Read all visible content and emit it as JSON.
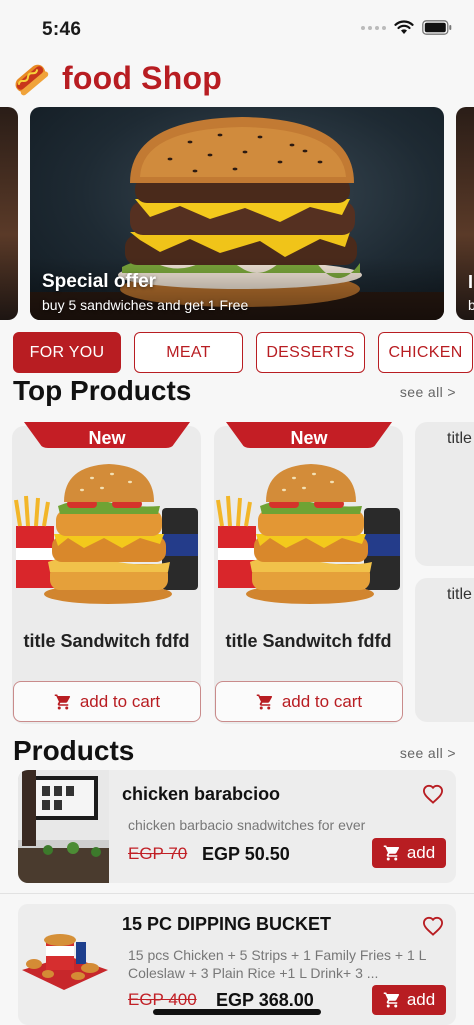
{
  "status_bar": {
    "time": "5:46"
  },
  "app": {
    "title": "food Shop"
  },
  "banner": {
    "title": "Special offer",
    "subtitle": "buy 5 sandwiches and get 1 Free",
    "next_peek_title": "I",
    "next_peek_sub": "b"
  },
  "categories": [
    {
      "label": "FOR YOU",
      "active": true
    },
    {
      "label": "MEAT",
      "active": false
    },
    {
      "label": "DESSERTS",
      "active": false
    },
    {
      "label": "CHICKEN",
      "active": false
    }
  ],
  "top_products": {
    "title": "Top Products",
    "see_all": "see all  >",
    "items": [
      {
        "badge": "New",
        "title": "title Sandwitch fdfd",
        "button": "add to cart"
      },
      {
        "badge": "New",
        "title": "title Sandwitch fdfd",
        "button": "add to cart"
      }
    ],
    "peek_titles": [
      "title",
      "title"
    ]
  },
  "products": {
    "title": "Products",
    "see_all": "see all  >",
    "items": [
      {
        "name": "chicken barabcioo",
        "description": "chicken barbacio snadwitches for ever",
        "old_price": "EGP 70",
        "new_price": "EGP 50.50",
        "button": "add"
      },
      {
        "name": "15 PC DIPPING BUCKET",
        "description": "15 pcs Chicken + 5 Strips + 1 Family Fries + 1 L Coleslaw + 3 Plain Rice +1 L Drink+ 3 ...",
        "old_price": "EGP 400",
        "new_price": "EGP 368.00",
        "button": "add"
      }
    ]
  },
  "colors": {
    "brand": "#b81d22",
    "card": "#ebebeb",
    "background": "#f7f7f7"
  },
  "icons": [
    "wifi-icon",
    "battery-icon",
    "hotdog-logo-icon",
    "cart-icon",
    "heart-outline-icon"
  ]
}
